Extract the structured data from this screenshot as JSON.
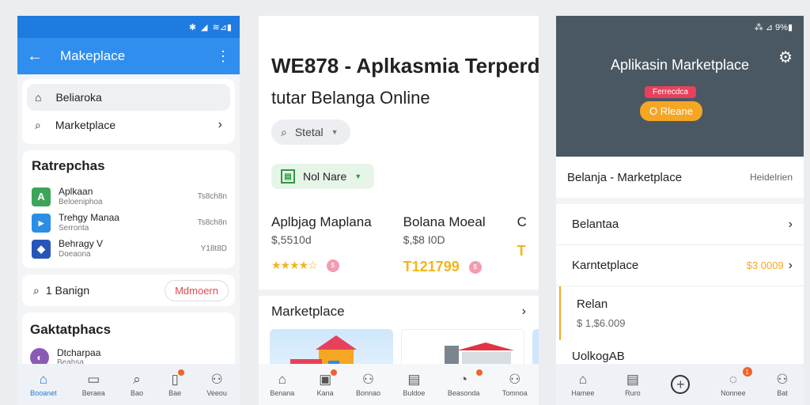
{
  "phone1": {
    "status": {
      "icons": [
        "bluetooth-icon",
        "vibrate-icon",
        "signal-icon",
        "battery-icon"
      ],
      "text": "≋⊿▮"
    },
    "appbar": {
      "back_glyph": "←",
      "title": "Makeplace",
      "more_glyph": "⋮"
    },
    "search": {
      "row1_label": "Beliaroka",
      "row2_label": "Marketplace",
      "chevron": "›"
    },
    "list": {
      "title": "Ratrepchas",
      "items": [
        {
          "title": "Aplkaan",
          "sub": "Beloeniphoa",
          "right": "Ts8ch8n",
          "color": "#3da55a",
          "glyph": "A"
        },
        {
          "title": "Trehgy Manaa",
          "sub": "Serronta",
          "right": "Ts8ch8n",
          "color": "#2b8ee6",
          "glyph": "▸"
        },
        {
          "title": "Behragy V",
          "sub": "Doeaona",
          "right": "Y18t8D",
          "color": "#2756b8",
          "glyph": "◆"
        }
      ]
    },
    "filter": {
      "label": "1 Banign",
      "chip": "Mdmoern"
    },
    "bottom_card": {
      "title": "Gaktatphacs",
      "item": "Dtcharpaa",
      "sub": "Beahsa"
    },
    "nav": [
      {
        "label": "Booanet",
        "glyph": "⌂",
        "active": true
      },
      {
        "label": "Beraea",
        "glyph": "▭"
      },
      {
        "label": "Bao",
        "glyph": "⌕"
      },
      {
        "label": "Bae",
        "glyph": "▯"
      },
      {
        "label": "Veeou",
        "glyph": "⚇"
      }
    ]
  },
  "phone2": {
    "title": "WE878 - Aplkasmia Terperd",
    "subtitle": "tutar Belanga Online",
    "search_label": "Stetal",
    "chip_label": "Nol Nare",
    "products": [
      {
        "name": "Aplbjag Maplana",
        "price": "$,5510d",
        "meta": "★★★★☆",
        "badge": "$"
      },
      {
        "name": "Bolana Moeal",
        "price": "$,$8 I0D",
        "meta": "T121799",
        "badge": "$"
      },
      {
        "name": "C",
        "price": "",
        "meta": "T",
        "badge": ""
      }
    ],
    "section_label": "Marketplace",
    "section_chevron": "›",
    "nav": [
      {
        "label": "Benana",
        "glyph": "⌂"
      },
      {
        "label": "Kana",
        "glyph": "▣"
      },
      {
        "label": "Bonnao",
        "glyph": "⚇"
      },
      {
        "label": "Buldoe",
        "glyph": "▤"
      },
      {
        "label": "Beasonda",
        "glyph": "◔"
      },
      {
        "label": "Tomnoa",
        "glyph": "⚇"
      }
    ]
  },
  "phone3": {
    "status_text": "⁂ ⊿ 9%▮",
    "header_title": "Aplikasin Marketplace",
    "gear_glyph": "⚙",
    "tag": "Ferrecdca",
    "cta": "O Rleane",
    "card_title": "Belanja - Marketplace",
    "card_right": "Heidelrien",
    "list": [
      {
        "label": "Belantaa",
        "value": ""
      },
      {
        "label": "Karntetplace",
        "value": "$3 0009"
      }
    ],
    "item2": {
      "name": "Relan",
      "value": "$ 1,$6.009"
    },
    "item3": "UolkogAB",
    "nav": [
      {
        "label": "Hamee",
        "glyph": "⌂"
      },
      {
        "label": "Ruro",
        "glyph": "▤"
      },
      {
        "label": "",
        "glyph": "+"
      },
      {
        "label": "Nonnee",
        "glyph": "◌",
        "badge": "1"
      },
      {
        "label": "Bat",
        "glyph": "⚇"
      }
    ]
  }
}
